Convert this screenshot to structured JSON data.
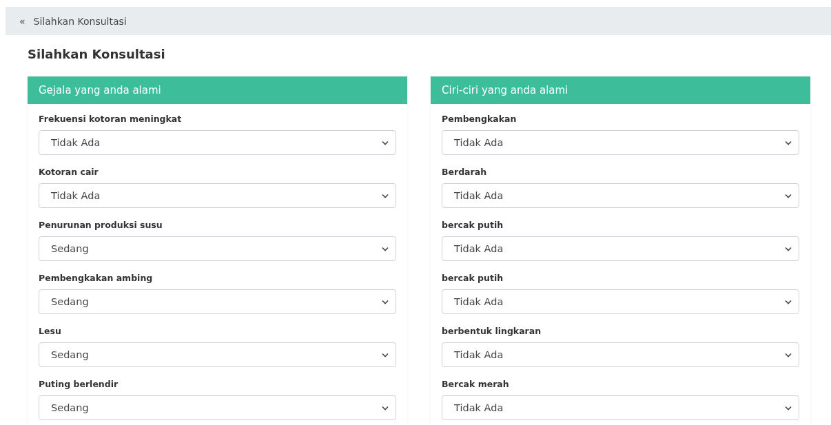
{
  "breadcrumb": {
    "icon": "«",
    "label": "Silahkan Konsultasi"
  },
  "title": "Silahkan Konsultasi",
  "panels": [
    {
      "header": "Gejala yang anda alami",
      "fields": [
        {
          "label": "Frekuensi kotoran meningkat",
          "value": "Tidak Ada"
        },
        {
          "label": "Kotoran cair",
          "value": "Tidak Ada"
        },
        {
          "label": "Penurunan produksi susu",
          "value": "Sedang"
        },
        {
          "label": "Pembengkakan ambing",
          "value": "Sedang"
        },
        {
          "label": "Lesu",
          "value": "Sedang"
        },
        {
          "label": "Puting berlendir",
          "value": "Sedang"
        }
      ]
    },
    {
      "header": "Ciri-ciri yang anda alami",
      "fields": [
        {
          "label": "Pembengkakan",
          "value": "Tidak Ada"
        },
        {
          "label": "Berdarah",
          "value": "Tidak Ada"
        },
        {
          "label": "bercak putih",
          "value": "Tidak Ada"
        },
        {
          "label": "bercak putih",
          "value": "Tidak Ada"
        },
        {
          "label": "berbentuk lingkaran",
          "value": "Tidak Ada"
        },
        {
          "label": "Bercak merah",
          "value": "Tidak Ada"
        }
      ]
    }
  ]
}
